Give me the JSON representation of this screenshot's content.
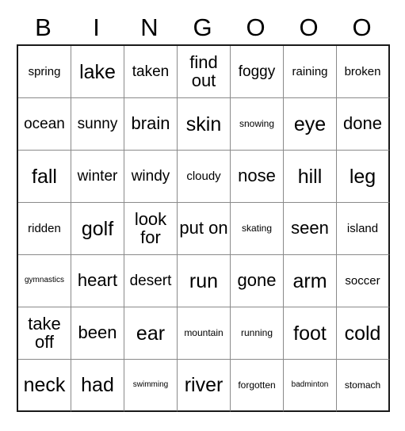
{
  "card": {
    "headers": [
      "B",
      "I",
      "N",
      "G",
      "O",
      "O",
      "O"
    ],
    "rows": [
      [
        {
          "text": "spring",
          "size": "s-sm"
        },
        {
          "text": "lake",
          "size": "s-xl"
        },
        {
          "text": "taken",
          "size": "s-md"
        },
        {
          "text": "find out",
          "size": "s-lg"
        },
        {
          "text": "foggy",
          "size": "s-md"
        },
        {
          "text": "raining",
          "size": "s-sm"
        },
        {
          "text": "broken",
          "size": "s-sm"
        }
      ],
      [
        {
          "text": "ocean",
          "size": "s-md"
        },
        {
          "text": "sunny",
          "size": "s-md"
        },
        {
          "text": "brain",
          "size": "s-lg"
        },
        {
          "text": "skin",
          "size": "s-xl"
        },
        {
          "text": "snowing",
          "size": "s-xs"
        },
        {
          "text": "eye",
          "size": "s-xl"
        },
        {
          "text": "done",
          "size": "s-lg"
        }
      ],
      [
        {
          "text": "fall",
          "size": "s-xl"
        },
        {
          "text": "winter",
          "size": "s-md"
        },
        {
          "text": "windy",
          "size": "s-md"
        },
        {
          "text": "cloudy",
          "size": "s-sm"
        },
        {
          "text": "nose",
          "size": "s-lg"
        },
        {
          "text": "hill",
          "size": "s-xl"
        },
        {
          "text": "leg",
          "size": "s-xl"
        }
      ],
      [
        {
          "text": "ridden",
          "size": "s-sm"
        },
        {
          "text": "golf",
          "size": "s-xl"
        },
        {
          "text": "look for",
          "size": "s-lg"
        },
        {
          "text": "put on",
          "size": "s-lg"
        },
        {
          "text": "skating",
          "size": "s-xs"
        },
        {
          "text": "seen",
          "size": "s-lg"
        },
        {
          "text": "island",
          "size": "s-sm"
        }
      ],
      [
        {
          "text": "gymnastics",
          "size": "s-xxs"
        },
        {
          "text": "heart",
          "size": "s-lg"
        },
        {
          "text": "desert",
          "size": "s-md"
        },
        {
          "text": "run",
          "size": "s-xl"
        },
        {
          "text": "gone",
          "size": "s-lg"
        },
        {
          "text": "arm",
          "size": "s-xl"
        },
        {
          "text": "soccer",
          "size": "s-sm"
        }
      ],
      [
        {
          "text": "take off",
          "size": "s-lg"
        },
        {
          "text": "been",
          "size": "s-lg"
        },
        {
          "text": "ear",
          "size": "s-xl"
        },
        {
          "text": "mountain",
          "size": "s-xs"
        },
        {
          "text": "running",
          "size": "s-xs"
        },
        {
          "text": "foot",
          "size": "s-xl"
        },
        {
          "text": "cold",
          "size": "s-xl"
        }
      ],
      [
        {
          "text": "neck",
          "size": "s-xl"
        },
        {
          "text": "had",
          "size": "s-xl"
        },
        {
          "text": "swimming",
          "size": "s-xxs"
        },
        {
          "text": "river",
          "size": "s-xl"
        },
        {
          "text": "forgotten",
          "size": "s-xs"
        },
        {
          "text": "badminton",
          "size": "s-xxs"
        },
        {
          "text": "stomach",
          "size": "s-xs"
        }
      ]
    ]
  }
}
